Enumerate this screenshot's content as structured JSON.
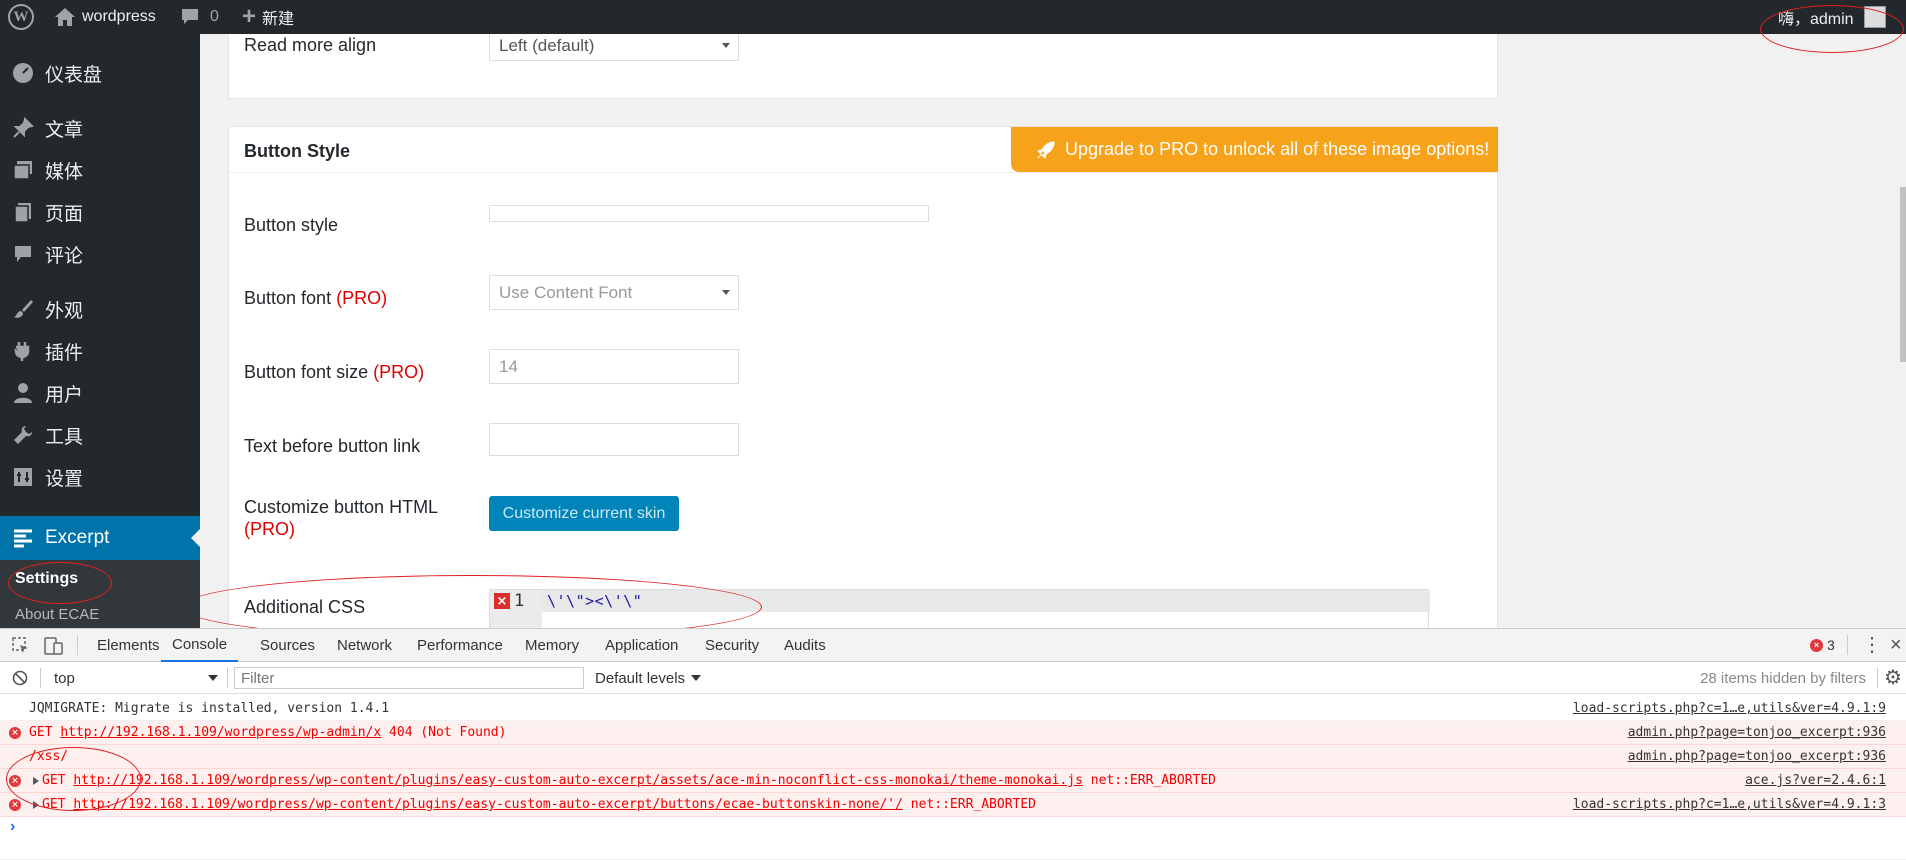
{
  "adminbar": {
    "site_name": "wordpress",
    "comments_count": "0",
    "new_label": "新建",
    "greeting": "嗨，admin"
  },
  "sidebar": {
    "items": [
      {
        "label": "仪表盘",
        "icon": "dashboard-icon"
      },
      {
        "label": "文章",
        "icon": "pin-icon"
      },
      {
        "label": "媒体",
        "icon": "media-icon"
      },
      {
        "label": "页面",
        "icon": "page-icon"
      },
      {
        "label": "评论",
        "icon": "comment-icon"
      },
      {
        "label": "外观",
        "icon": "brush-icon"
      },
      {
        "label": "插件",
        "icon": "plugin-icon"
      },
      {
        "label": "用户",
        "icon": "user-icon"
      },
      {
        "label": "工具",
        "icon": "wrench-icon"
      },
      {
        "label": "设置",
        "icon": "settings-icon"
      },
      {
        "label": "Excerpt",
        "icon": "excerpt-icon"
      }
    ],
    "submenu": [
      "Settings",
      "About ECAE"
    ]
  },
  "content": {
    "top_label": "Read more align",
    "top_value": "Left (default)",
    "section_title": "Button Style",
    "upgrade_banner": "Upgrade to PRO to unlock all of these image options!",
    "pro_tag": "(PRO)",
    "button_style_label": "Button style",
    "button_font_label": "Button font",
    "button_font_value": "Use Content Font",
    "button_font_size_label": "Button font size",
    "button_font_size_value": "14",
    "text_before_label": "Text before button link",
    "customize_html_label": "Customize button HTML",
    "customize_button": "Customize current skin",
    "additional_css_label": "Additional CSS",
    "editor_line_number": "1",
    "editor_code": "\\'\\\"><\\'\\\""
  },
  "devtools": {
    "tabs": [
      "Elements",
      "Console",
      "Sources",
      "Network",
      "Performance",
      "Memory",
      "Application",
      "Security",
      "Audits"
    ],
    "active_tab": "Console",
    "error_count": "3",
    "context": "top",
    "filter_placeholder": "Filter",
    "levels": "Default levels",
    "hidden_note": "28 items hidden by filters",
    "logs": [
      {
        "type": "info",
        "msg": "JQMIGRATE: Migrate is installed, version 1.4.1",
        "src": "load-scripts.php?c=1…e,utils&ver=4.9.1:9"
      },
      {
        "type": "error",
        "method": "GET",
        "url": "http://192.168.1.109/wordpress/wp-admin/x",
        "suffix": "404 (Not Found)",
        "src": "admin.php?page=tonjoo_excerpt:936"
      },
      {
        "type": "plain",
        "msg": "/xss/",
        "src": "admin.php?page=tonjoo_excerpt:936"
      },
      {
        "type": "error",
        "method": "GET",
        "url": "http://192.168.1.109/wordpress/wp-content/plugins/easy-custom-auto-excerpt/assets/ace-min-noconflict-css-monokai/theme-monokai.js",
        "suffix": "net::ERR_ABORTED",
        "src": "ace.js?ver=2.4.6:1"
      },
      {
        "type": "error",
        "method": "GET",
        "url": "http://192.168.1.109/wordpress/wp-content/plugins/easy-custom-auto-excerpt/buttons/ecae-buttonskin-none/'/",
        "suffix": "net::ERR_ABORTED",
        "src": "load-scripts.php?c=1…e,utils&ver=4.9.1:3"
      }
    ]
  },
  "colors": {
    "adminbar": "#23282d",
    "active_menu": "#0073aa",
    "upgrade_orange": "#f7a21b",
    "pro_red": "#dc0000",
    "error_red": "#e00000"
  }
}
